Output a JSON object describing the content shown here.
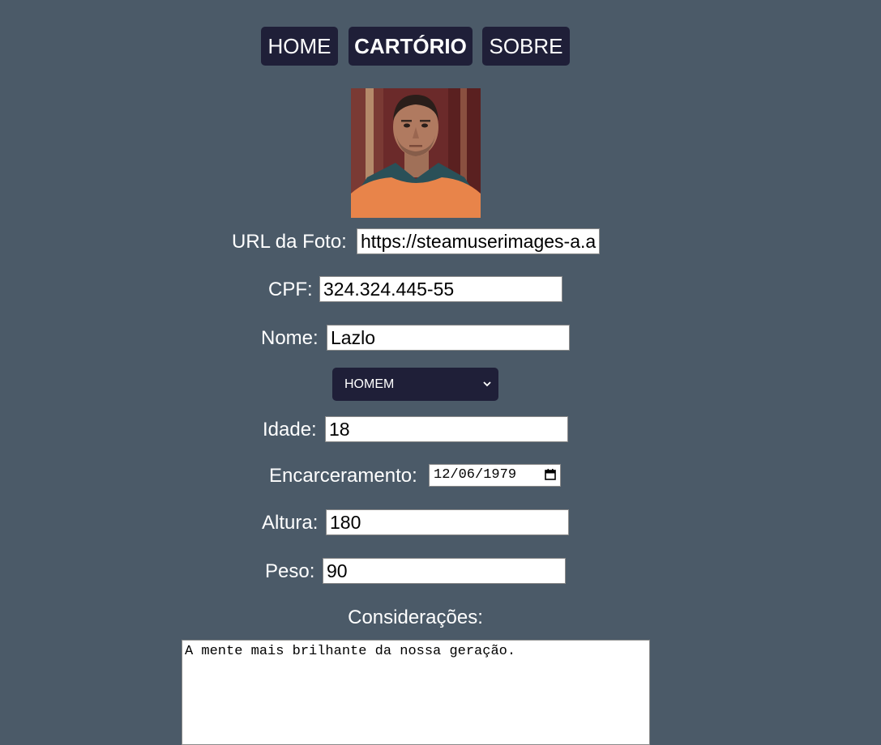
{
  "nav": {
    "home_label": "HOME",
    "cartorio_label": "CARTÓRIO",
    "sobre_label": "SOBRE"
  },
  "form": {
    "foto": {
      "label": "URL da Foto:",
      "value": "https://steamuserimages-a.a"
    },
    "cpf": {
      "label": "CPF:",
      "value": "324.324.445-55"
    },
    "nome": {
      "label": "Nome:",
      "value": "Lazlo"
    },
    "sexo": {
      "selected": "HOMEM"
    },
    "idade": {
      "label": "Idade:",
      "value": "18"
    },
    "encarceramento": {
      "label": "Encarceramento:",
      "value": "12/06/1979"
    },
    "altura": {
      "label": "Altura:",
      "value": "180"
    },
    "peso": {
      "label": "Peso:",
      "value": "90"
    },
    "consideracoes": {
      "label": "Considerações:",
      "value": "A mente mais brilhante da nossa geração."
    }
  },
  "icons": {
    "select_arrow": "chevron-down-icon",
    "date_picker": "calendar-icon"
  },
  "colors": {
    "background": "#4b5a68",
    "button": "#1f1f38",
    "text": "#ffffff"
  }
}
